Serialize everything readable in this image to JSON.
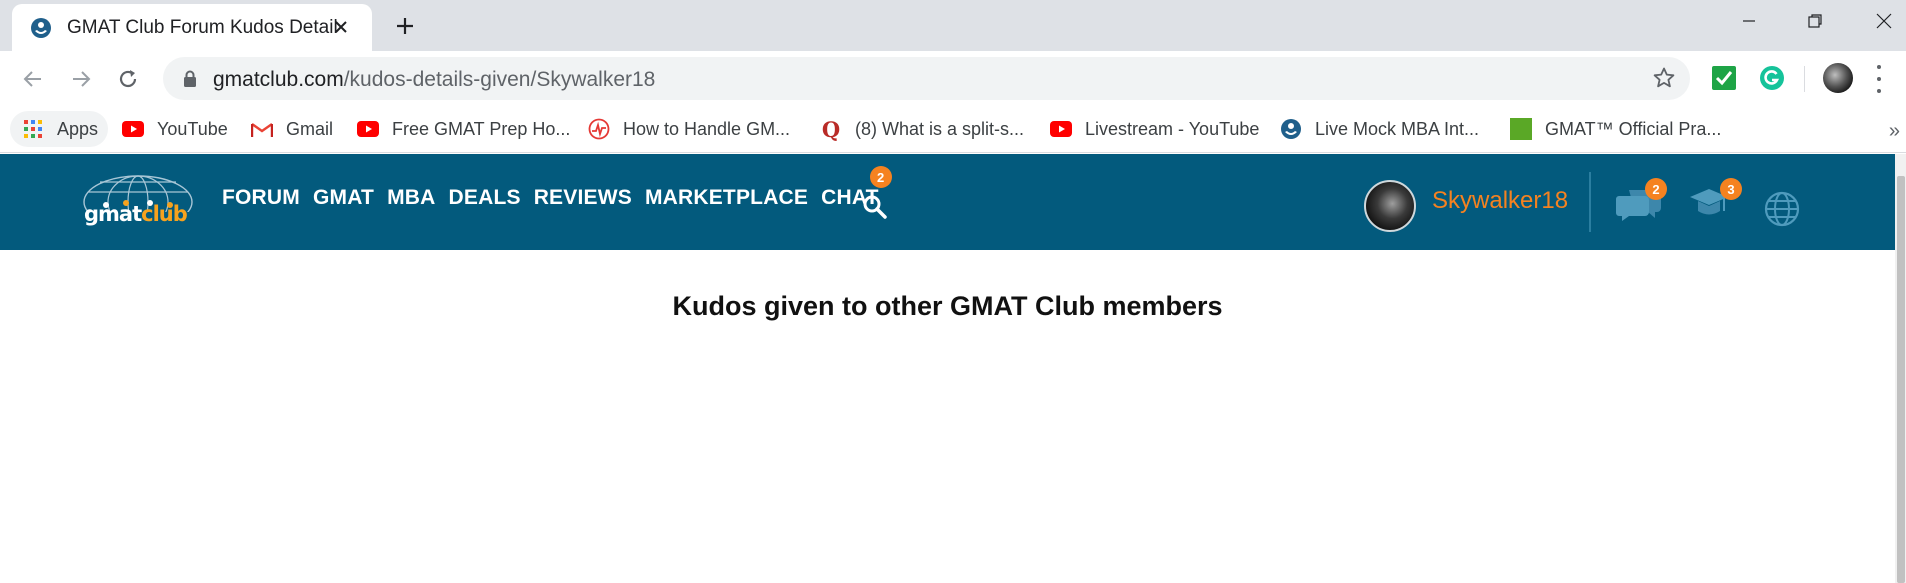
{
  "tab": {
    "title": "GMAT Club Forum Kudos Details",
    "favicon": "gmatclub-favicon"
  },
  "address_bar": {
    "host": "gmatclub.com",
    "path": "/kudos-details-given/Skywalker18"
  },
  "bookmarks": [
    {
      "label": "Apps",
      "icon": "apps-grid-icon"
    },
    {
      "label": "YouTube",
      "icon": "youtube-icon"
    },
    {
      "label": "Gmail",
      "icon": "gmail-icon"
    },
    {
      "label": "Free GMAT Prep Ho...",
      "icon": "youtube-icon"
    },
    {
      "label": "How to Handle GM...",
      "icon": "pulse-icon"
    },
    {
      "label": "(8) What is a split-s...",
      "icon": "quora-icon"
    },
    {
      "label": "Livestream - YouTube",
      "icon": "youtube-icon"
    },
    {
      "label": "Live Mock MBA Int...",
      "icon": "gmatclub-favicon"
    },
    {
      "label": "GMAT™ Official Pra...",
      "icon": "green-square-icon"
    }
  ],
  "bookmarks_overflow": "»",
  "site_header": {
    "logo": {
      "part1": "gmat",
      "part2": "club"
    },
    "nav": [
      "FORUM",
      "GMAT",
      "MBA",
      "DEALS",
      "REVIEWS",
      "MARKETPLACE",
      "CHAT"
    ],
    "chat_badge": "2",
    "username": "Skywalker18",
    "messages_badge": "2",
    "school_badge": "3"
  },
  "main": {
    "heading": "Kudos given to other GMAT Club members"
  },
  "colors": {
    "header_bg": "#035a7d",
    "accent_orange": "#f58220",
    "tabstrip_bg": "#dee1e6"
  }
}
